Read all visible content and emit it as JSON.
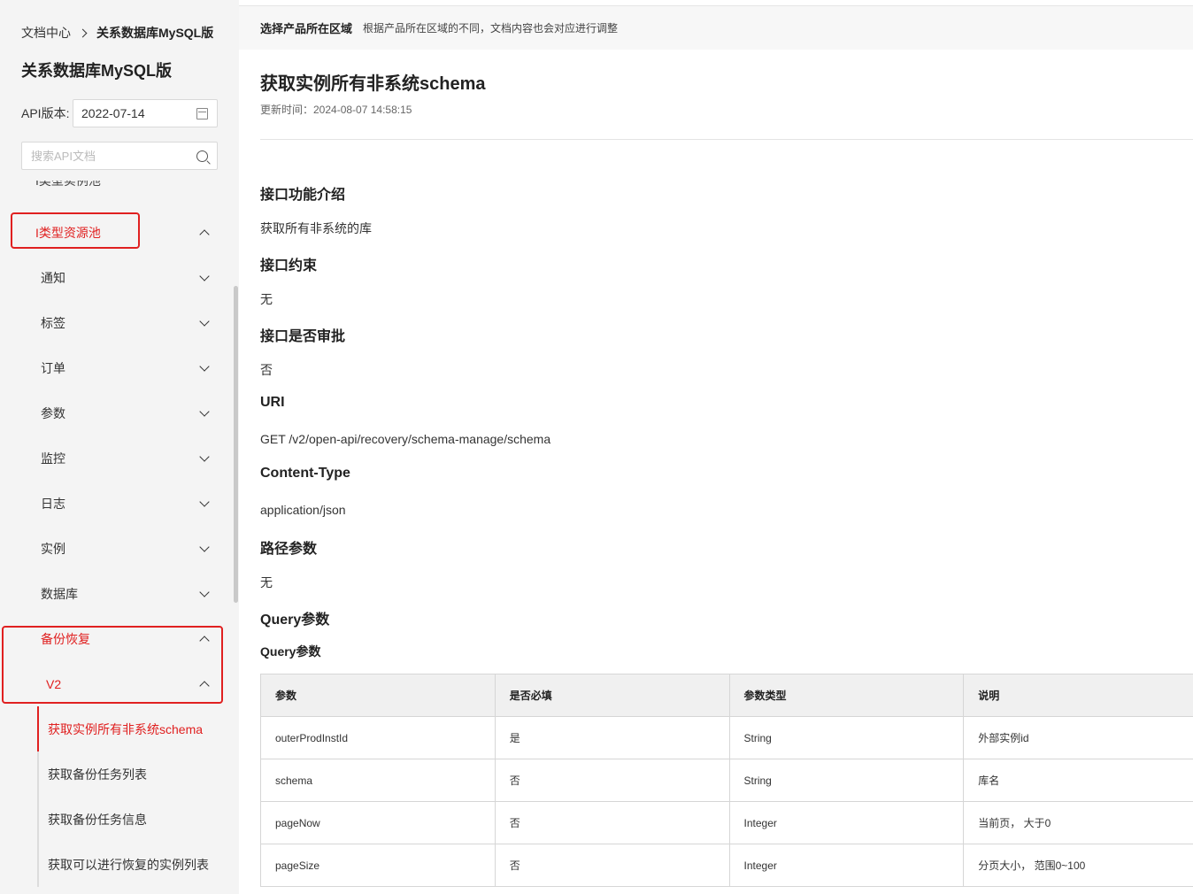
{
  "sidebar": {
    "breadcrumb": {
      "home": "文档中心",
      "current": "关系数据库MySQL版"
    },
    "title": "关系数据库MySQL版",
    "version": {
      "label": "API版本:",
      "value": "2022-07-14"
    },
    "search": {
      "placeholder": "搜索API文档"
    },
    "cut_item": "I类型实例池",
    "items": [
      {
        "label": "I类型资源池",
        "state": "expanded"
      },
      {
        "label": "通知",
        "state": "collapsed"
      },
      {
        "label": "标签",
        "state": "collapsed"
      },
      {
        "label": "订单",
        "state": "collapsed"
      },
      {
        "label": "参数",
        "state": "collapsed"
      },
      {
        "label": "监控",
        "state": "collapsed"
      },
      {
        "label": "日志",
        "state": "collapsed"
      },
      {
        "label": "实例",
        "state": "collapsed"
      },
      {
        "label": "数据库",
        "state": "collapsed"
      },
      {
        "label": "备份恢复",
        "state": "expanded"
      },
      {
        "label": "V2",
        "state": "expanded"
      }
    ],
    "sub_items": [
      {
        "label": "获取实例所有非系统schema",
        "selected": true
      },
      {
        "label": "获取备份任务列表",
        "selected": false
      },
      {
        "label": "获取备份任务信息",
        "selected": false
      },
      {
        "label": "获取可以进行恢复的实例列表",
        "selected": false
      }
    ],
    "accent_color": "#e02020"
  },
  "main": {
    "region": {
      "title": "选择产品所在区域",
      "desc": "根据产品所在区域的不同，文档内容也会对应进行调整"
    },
    "title": "获取实例所有非系统schema",
    "updated": "更新时间：2024-08-07 14:58:15",
    "sections": {
      "intro": {
        "heading": "接口功能介绍",
        "text": "获取所有非系统的库"
      },
      "constraint": {
        "heading": "接口约束",
        "text": "无"
      },
      "approval": {
        "heading": "接口是否审批",
        "text": "否"
      },
      "uri": {
        "heading": "URI",
        "text": "GET /v2/open-api/recovery/schema-manage/schema"
      },
      "content_type": {
        "heading": "Content-Type",
        "text": "application/json"
      },
      "path_params": {
        "heading": "路径参数",
        "text": "无"
      },
      "query_params": {
        "heading": "Query参数",
        "subheading": "Query参数"
      }
    },
    "table": {
      "headers": [
        "参数",
        "是否必填",
        "参数类型",
        "说明"
      ],
      "rows": [
        [
          "outerProdInstId",
          "是",
          "String",
          "外部实例id"
        ],
        [
          "schema",
          "否",
          "String",
          "库名"
        ],
        [
          "pageNow",
          "否",
          "Integer",
          "当前页， 大于0"
        ],
        [
          "pageSize",
          "否",
          "Integer",
          "分页大小， 范围0~100"
        ]
      ]
    }
  }
}
